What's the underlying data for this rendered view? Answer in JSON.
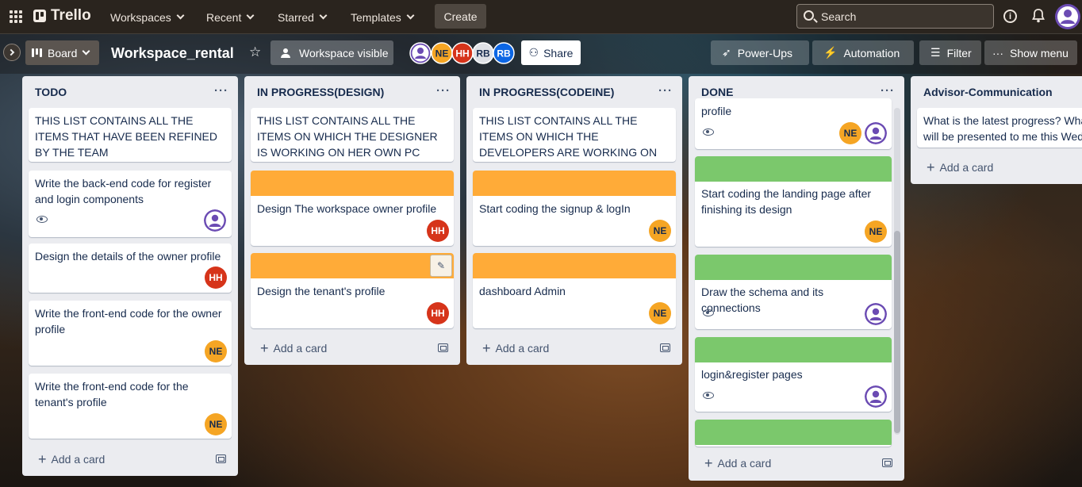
{
  "nav": {
    "brand": "Trello",
    "workspaces": "Workspaces",
    "recent": "Recent",
    "starred": "Starred",
    "templates": "Templates",
    "create": "Create",
    "search_placeholder": "Search"
  },
  "board": {
    "view": "Board",
    "title": "Workspace_rental",
    "visibility": "Workspace visible",
    "members": [
      "NE",
      "HH",
      "RB",
      "RB"
    ],
    "share": "Share",
    "power_ups": "Power-Ups",
    "automation": "Automation",
    "filter": "Filter",
    "show_menu": "Show menu"
  },
  "lists": [
    {
      "title": "TODO",
      "cards": [
        {
          "text": "THIS LIST CONTAINS ALL THE ITEMS THAT HAVE BEEN REFINED BY THE TEAM"
        },
        {
          "text": "Write the back-end code for register and login components"
        },
        {
          "text": "Design the details of the owner profile",
          "member": "HH"
        },
        {
          "text": "Write the front-end code for the owner profile",
          "member": "NE"
        },
        {
          "text": "Write the front-end code for the tenant's profile",
          "member": "NE"
        }
      ],
      "add_card": "Add a card"
    },
    {
      "title": "IN PROGRESS(DESIGN)",
      "cards": [
        {
          "text": "THIS LIST CONTAINS ALL THE ITEMS ON WHICH THE DESIGNER IS WORKING ON HER OWN PC"
        },
        {
          "text": "Design The workspace owner profile",
          "member": "HH"
        },
        {
          "text": "Design the tenant's profile",
          "member": "HH"
        }
      ],
      "add_card": "Add a card"
    },
    {
      "title": "IN PROGRESS(CODEINE)",
      "cards": [
        {
          "text": "THIS LIST CONTAINS ALL THE ITEMS ON WHICH THE DEVELOPERS ARE WORKING ON THEIR OWN PC"
        },
        {
          "text": "Start coding the signup & logIn",
          "member": "NE"
        },
        {
          "text": "dashboard Admin",
          "member": "NE"
        }
      ],
      "add_card": "Add a card"
    },
    {
      "title": "DONE",
      "cards": [
        {
          "text": "profile",
          "member": "NE"
        },
        {
          "text": "Start coding the landing page after finishing its design",
          "member": "NE"
        },
        {
          "text": "Draw the schema and its connections"
        },
        {
          "text": "login&register pages"
        },
        {
          "text": ""
        }
      ],
      "add_card": "Add a card"
    },
    {
      "title": "Advisor-Communication",
      "cards": [
        {
          "text": "What is the latest progress? What will be presented to me this Wed.?"
        }
      ],
      "add_card": "Add a card"
    }
  ],
  "colors": {
    "cover_orange": "#ffab38",
    "cover_green": "#7bc86c",
    "avatar_hh": "#d6341a",
    "avatar_ne": "#f5a524",
    "avatar_rb": "#0c66e4"
  },
  "icons": [
    "apps-grid-icon",
    "chevron-down-icon",
    "search-icon",
    "info-icon",
    "bell-icon",
    "star-icon",
    "eye-icon",
    "pencil-icon",
    "template-icon",
    "ellipsis-icon"
  ]
}
